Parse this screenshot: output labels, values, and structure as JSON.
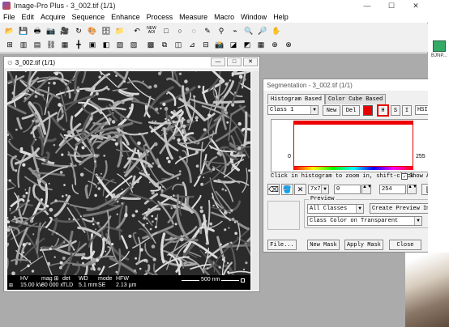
{
  "app": {
    "title": "Image-Pro Plus - 3_002.tif (1/1)",
    "window_buttons": [
      "—",
      "☐",
      "✕"
    ]
  },
  "menu": [
    "File",
    "Edit",
    "Acquire",
    "Sequence",
    "Enhance",
    "Process",
    "Measure",
    "Macro",
    "Window",
    "Help"
  ],
  "toolbar": {
    "new_aoi_label": "NEW AOI"
  },
  "image_window": {
    "title": "3_002.tif (1/1)",
    "buttons": [
      "—",
      "□",
      "✕"
    ],
    "databar": {
      "headers": [
        "HV",
        "mag ⊞",
        "det",
        "WD",
        "mode",
        "HFW"
      ],
      "values": [
        "15.00 kV",
        "80 000 x",
        "TLD",
        "5.1 mm",
        "SE",
        "2.13 µm"
      ],
      "scale_label": "500 nm"
    }
  },
  "segmentation": {
    "title": "Segmentation - 3_002.tif (1/1)",
    "tabs": [
      "Histogram Based",
      "Color Cube Based"
    ],
    "class_select": "Class 1",
    "new_label": "New",
    "del_label": "Del",
    "channel_buttons": [
      "H",
      "S",
      "I"
    ],
    "color_model": "HSI",
    "hist_min_label": "0",
    "hist_max_label": "255",
    "note": "Click in histogram to zoom in, shift-click",
    "show_all_label": "Show All",
    "show_all_checked": "✓",
    "kernel_size": "7x7",
    "range_min": "0",
    "range_max": "254",
    "preview_legend": "Preview",
    "preview_classes": "All Classes",
    "create_preview_label": "Create Preview Image",
    "preview_mode": "Class Color on Transparent",
    "file_label": "File...",
    "new_mask_label": "New Mask",
    "apply_mask_label": "Apply Mask",
    "close_label": "Close",
    "class_color": "#e60000",
    "selected_channel_color": "#e60000"
  },
  "desktop": {
    "icon_label": "BJNP..."
  }
}
